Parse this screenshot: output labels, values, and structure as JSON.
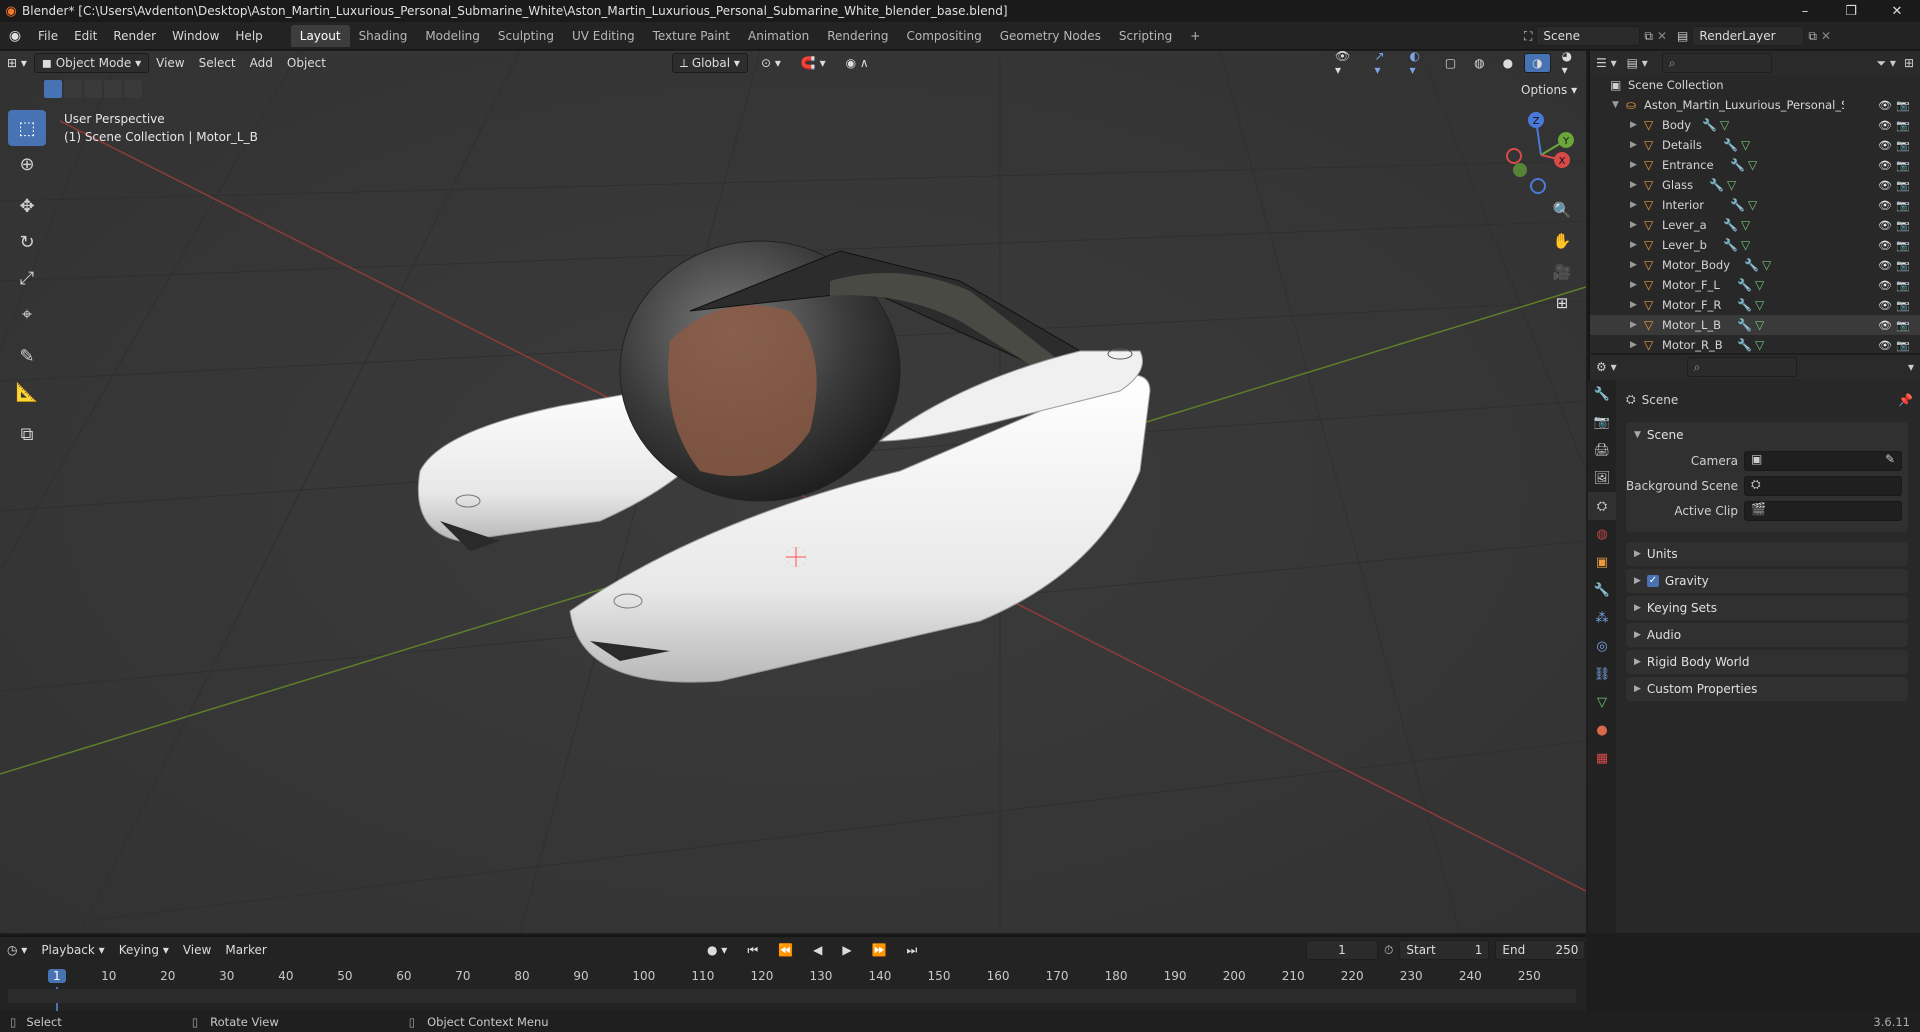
{
  "titlebar": {
    "title": "Blender* [C:\\Users\\Avdenton\\Desktop\\Aston_Martin_Luxurious_Personal_Submarine_White\\Aston_Martin_Luxurious_Personal_Submarine_White_blender_base.blend]",
    "controls": [
      "–",
      "❐",
      "✕"
    ]
  },
  "topbar": {
    "menus": [
      "File",
      "Edit",
      "Render",
      "Window",
      "Help"
    ],
    "workspaces": [
      "Layout",
      "Shading",
      "Modeling",
      "Sculpting",
      "UV Editing",
      "Texture Paint",
      "Animation",
      "Rendering",
      "Compositing",
      "Geometry Nodes",
      "Scripting"
    ],
    "active_workspace": "Layout",
    "add_tab": "+",
    "scene_name": "Scene",
    "view_layer": "RenderLayer"
  },
  "viewport_header": {
    "mode": "Object Mode",
    "menus": [
      "View",
      "Select",
      "Add",
      "Object"
    ],
    "transform_orientation": "Global",
    "options_label": "Options"
  },
  "viewport": {
    "perspective": "User Perspective",
    "collection_info": "(1) Scene Collection | Motor_L_B"
  },
  "toolbar": {
    "tools": [
      "select-box",
      "cursor",
      "move",
      "rotate",
      "scale",
      "transform",
      "annotate",
      "measure",
      "add-cube"
    ]
  },
  "gizmo": {
    "z": "Z",
    "y": "Y",
    "x": "X"
  },
  "outliner": {
    "root": "Scene Collection",
    "collection": "Aston_Martin_Luxurious_Personal_Subm",
    "objects": [
      "Body",
      "Details",
      "Entrance",
      "Glass",
      "Interior",
      "Lever_a",
      "Lever_b",
      "Motor_Body",
      "Motor_F_L",
      "Motor_F_R",
      "Motor_L_B",
      "Motor_R_B"
    ],
    "selected": "Motor_L_B"
  },
  "properties": {
    "context": "Scene",
    "scene_panel": {
      "title": "Scene",
      "camera_label": "Camera",
      "background_label": "Background Scene",
      "clip_label": "Active Clip"
    },
    "subpanels": [
      "Units",
      "Gravity",
      "Keying Sets",
      "Audio",
      "Rigid Body World",
      "Custom Properties"
    ],
    "gravity_checked": true
  },
  "timeline": {
    "menus": [
      "Playback",
      "Keying",
      "View",
      "Marker"
    ],
    "current_frame": "1",
    "start_label": "Start",
    "start": "1",
    "end_label": "End",
    "end": "250",
    "ticks": [
      "1",
      "10",
      "20",
      "30",
      "40",
      "50",
      "60",
      "70",
      "80",
      "90",
      "100",
      "110",
      "120",
      "130",
      "140",
      "150",
      "160",
      "170",
      "180",
      "190",
      "200",
      "210",
      "220",
      "230",
      "240",
      "250"
    ]
  },
  "statusbar": {
    "select": "Select",
    "rotate": "Rotate View",
    "context_menu": "Object Context Menu",
    "version": "3.6.11"
  },
  "colors": {
    "accent": "#4772b3",
    "active_frame": "#4772b3",
    "selection_orange": "#e89a3c"
  }
}
